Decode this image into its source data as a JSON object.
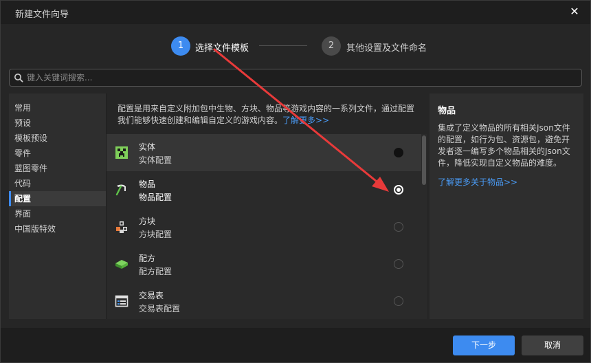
{
  "window": {
    "title": "新建文件向导",
    "close_symbol": "✕"
  },
  "steps": [
    {
      "number": "1",
      "label": "选择文件模板",
      "active": true
    },
    {
      "number": "2",
      "label": "其他设置及文件命名",
      "active": false
    }
  ],
  "search": {
    "placeholder": "键入关键词搜索...",
    "value": ""
  },
  "sidebar": {
    "items": [
      {
        "label": "常用"
      },
      {
        "label": "预设"
      },
      {
        "label": "模板预设"
      },
      {
        "label": "零件"
      },
      {
        "label": "蓝图零件"
      },
      {
        "label": "代码"
      },
      {
        "label": "配置",
        "active": true
      },
      {
        "label": "界面"
      },
      {
        "label": "中国版特效"
      }
    ]
  },
  "center": {
    "description": "配置是用来自定义附加包中生物、方块、物品等游戏内容的一系列文件，通过配置我们能够快速创建和编辑自定义的游戏内容。",
    "learn_more": "了解更多>>"
  },
  "templates": [
    {
      "name": "实体",
      "sub": "实体配置",
      "icon": "creeper-icon",
      "state": "hover"
    },
    {
      "name": "物品",
      "sub": "物品配置",
      "icon": "pickaxe-icon",
      "state": "selected"
    },
    {
      "name": "方块",
      "sub": "方块配置",
      "icon": "blocks-icon",
      "state": ""
    },
    {
      "name": "配方",
      "sub": "配方配置",
      "icon": "book-icon",
      "state": ""
    },
    {
      "name": "交易表",
      "sub": "交易表配置",
      "icon": "window-icon",
      "state": ""
    }
  ],
  "detail": {
    "title": "物品",
    "description": "集成了定义物品的所有相关Json文件的配置，如行为包、资源包，避免开发者逐一编写多个物品相关的Json文件，降低实现自定义物品的难度。",
    "link": "了解更多关于物品>>"
  },
  "footer": {
    "next_label": "下一步",
    "cancel_label": "取消"
  },
  "colors": {
    "accent": "#3d8bf0",
    "link": "#4a9bf5",
    "annotation_arrow": "#e83a3a"
  }
}
